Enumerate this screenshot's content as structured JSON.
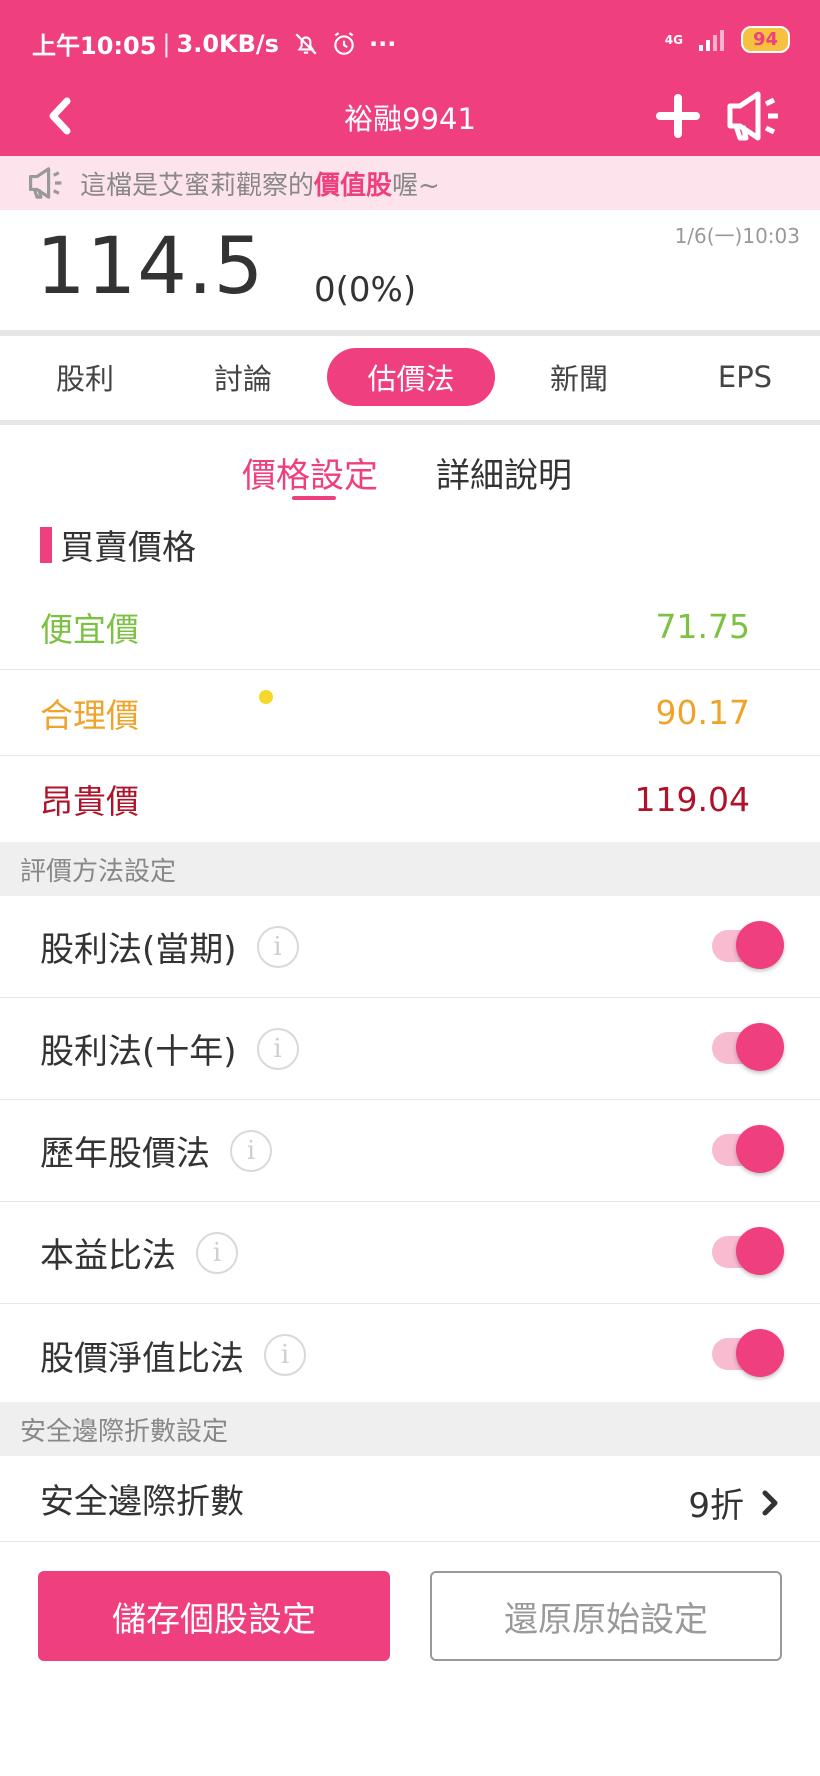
{
  "status_bar": {
    "time": "上午10:05",
    "speed": "3.0KB/s",
    "dots": "···",
    "network": "4G",
    "battery": "94"
  },
  "nav": {
    "title": "裕融9941"
  },
  "announcement": {
    "prefix": "這檔是艾蜜莉觀察的",
    "highlight": "價值股",
    "suffix": "喔~"
  },
  "quote": {
    "price": "114.5",
    "change": "0(0%)",
    "time": "1/6(一)10:03"
  },
  "tabs": [
    {
      "label": "股利"
    },
    {
      "label": "討論"
    },
    {
      "label": "估價法"
    },
    {
      "label": "新聞"
    },
    {
      "label": "EPS"
    }
  ],
  "subtabs": {
    "settings": "價格設定",
    "details": "詳細說明"
  },
  "trade_section": {
    "title": "買賣價格",
    "rows": [
      {
        "label": "便宜價",
        "value": "71.75",
        "color": "#7cc242"
      },
      {
        "label": "合理價",
        "value": "90.17",
        "color": "#f0a32a"
      },
      {
        "label": "昂貴價",
        "value": "119.04",
        "color": "#b0122a"
      }
    ]
  },
  "method_section": {
    "header": "評價方法設定",
    "info_glyph": "i",
    "methods": [
      {
        "label": "股利法(當期)",
        "enabled": true
      },
      {
        "label": "股利法(十年)",
        "enabled": true
      },
      {
        "label": "歷年股價法",
        "enabled": true
      },
      {
        "label": "本益比法",
        "enabled": true
      },
      {
        "label": "股價淨值比法",
        "enabled": true
      }
    ]
  },
  "margin_section": {
    "header": "安全邊際折數設定",
    "label": "安全邊際折數",
    "value": "9折"
  },
  "buttons": {
    "save": "儲存個股設定",
    "reset": "還原原始設定"
  },
  "colors": {
    "accent": "#ef3f7f",
    "cheap": "#7cc242",
    "fair": "#f0a32a",
    "expensive": "#b0122a"
  }
}
